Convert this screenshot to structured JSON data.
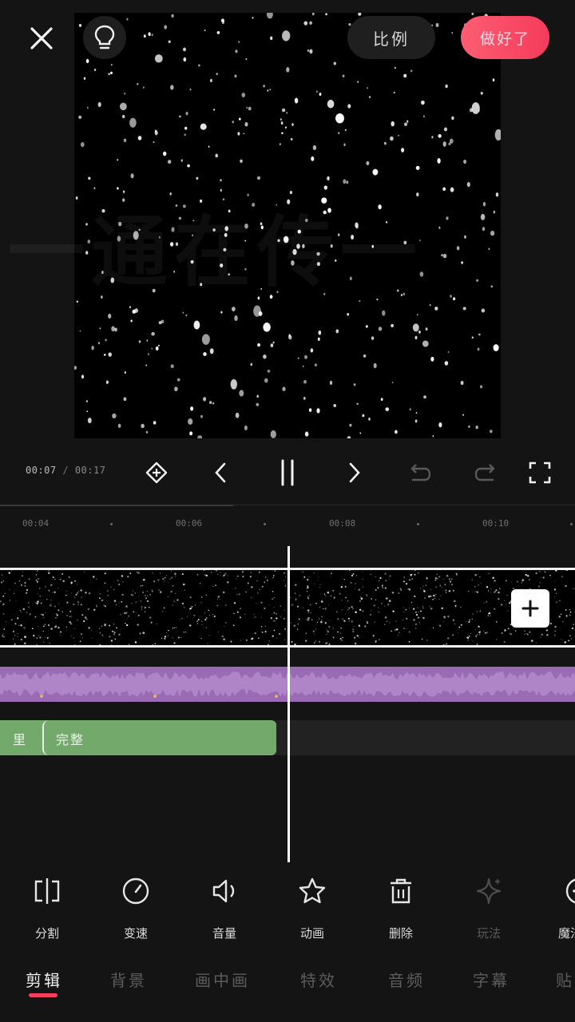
{
  "top_bar": {
    "ratio_label": "比例",
    "done_label": "做好了"
  },
  "preview": {
    "ghost_text": "一通在传一"
  },
  "playback": {
    "current_time": "00:07",
    "separator": " / ",
    "total_time": "00:17"
  },
  "ruler": {
    "labels": [
      "00:04",
      "00:06",
      "00:08",
      "00:10"
    ]
  },
  "text_track": {
    "label_1": "里",
    "label_2": "完整"
  },
  "tools": [
    {
      "label": "分割",
      "icon": "split-icon"
    },
    {
      "label": "变速",
      "icon": "speed-icon"
    },
    {
      "label": "音量",
      "icon": "volume-icon"
    },
    {
      "label": "动画",
      "icon": "star-icon"
    },
    {
      "label": "删除",
      "icon": "trash-icon"
    },
    {
      "label": "玩法",
      "icon": "sparkle-icon"
    },
    {
      "label": "魔法",
      "icon": "magic-icon"
    }
  ],
  "tabs": [
    "剪辑",
    "背景",
    "画中画",
    "特效",
    "音频",
    "字幕",
    "贴"
  ],
  "colors": {
    "accent": "#f4405e",
    "audio_track": "#9a6bb4",
    "text_clip": "#74a96c",
    "background": "#141414"
  }
}
